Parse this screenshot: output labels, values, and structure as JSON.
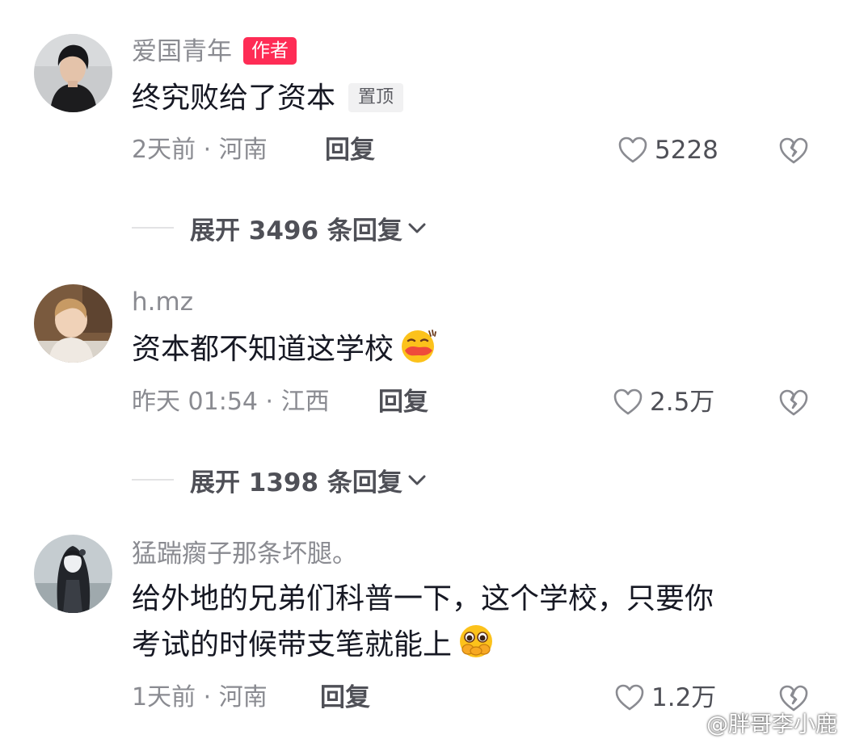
{
  "comments": [
    {
      "username": "爱国青年",
      "author_badge": "作者",
      "content": "终究败给了资本",
      "pinned_badge": "置顶",
      "time_location": "2天前 · 河南",
      "reply_label": "回复",
      "likes": "5228",
      "expand_label": "展开 3496 条回复",
      "avatar": "young-man-dark-hair-photo"
    },
    {
      "username": "h.mz",
      "content": "资本都不知道这学校",
      "emoji": "smirk-lips-emoji",
      "time_location": "昨天 01:54 · 江西",
      "reply_label": "回复",
      "likes": "2.5万",
      "expand_label": "展开 1398 条回复",
      "avatar": "toddler-photo"
    },
    {
      "username": "猛踹瘸子那条坏腿。",
      "content_line1": "给外地的兄弟们科普一下，这个学校，只要你",
      "content_line2": "考试的时候带支笔就能上",
      "emoji": "covering-mouth-teary-emoji",
      "time_location": "1天前 · 河南",
      "reply_label": "回复",
      "likes": "1.2万",
      "avatar": "anime-girl-illustration"
    }
  ],
  "icons": {
    "like": "heart-outline-icon",
    "dislike": "broken-heart-icon",
    "expand": "chevron-down-icon",
    "watermark": "weibo-logo-icon"
  },
  "watermark": {
    "text": "@胖哥李小鹿"
  },
  "colors": {
    "author_badge": "#fe2c55",
    "username": "#8a8b91",
    "content": "#161823",
    "secondary": "#4f5057"
  }
}
